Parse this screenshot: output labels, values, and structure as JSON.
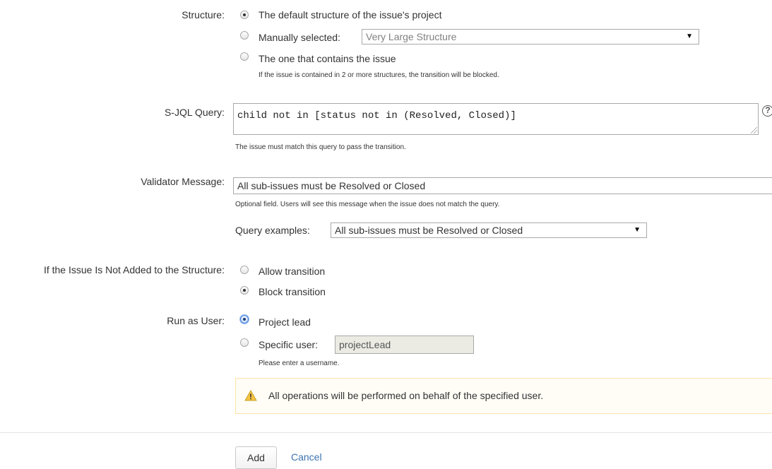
{
  "structure": {
    "label": "Structure:",
    "option_default": "The default structure of the issue's project",
    "option_manual": "Manually selected:",
    "manual_select_value": "Very Large Structure",
    "option_contains": "The one that contains the issue",
    "contains_hint": "If the issue is contained in 2 or more structures, the transition will be blocked.",
    "selected": "default"
  },
  "sjql": {
    "label": "S-JQL Query:",
    "value": "child not in [status not in (Resolved, Closed)]",
    "hint": "The issue must match this query to pass the transition."
  },
  "validator": {
    "label": "Validator Message:",
    "value": "All sub-issues must be Resolved or Closed",
    "hint": "Optional field. Users will see this message when the issue does not match the query.",
    "examples_label": "Query examples:",
    "examples_value": "All sub-issues must be Resolved or Closed"
  },
  "not_added": {
    "label": "If the Issue Is Not Added to the Structure:",
    "option_allow": "Allow transition",
    "option_block": "Block transition",
    "selected": "block"
  },
  "run_as": {
    "label": "Run as User:",
    "option_lead": "Project lead",
    "option_specific": "Specific user:",
    "specific_value": "projectLead",
    "specific_hint": "Please enter a username.",
    "selected": "lead"
  },
  "warning": {
    "text": "All operations will be performed on behalf of the specified user.",
    "icon": "warning-icon",
    "color": "#f6c342"
  },
  "actions": {
    "add_label": "Add",
    "cancel_label": "Cancel"
  },
  "help": {
    "icon": "help-icon",
    "glyph": "?"
  }
}
